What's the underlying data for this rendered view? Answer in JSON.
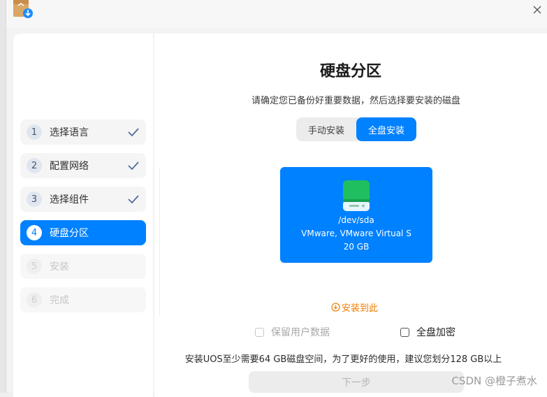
{
  "steps": [
    {
      "num": "1",
      "label": "选择语言",
      "state": "done"
    },
    {
      "num": "2",
      "label": "配置网络",
      "state": "done"
    },
    {
      "num": "3",
      "label": "选择组件",
      "state": "done"
    },
    {
      "num": "4",
      "label": "硬盘分区",
      "state": "active"
    },
    {
      "num": "5",
      "label": "安装",
      "state": "disabled"
    },
    {
      "num": "6",
      "label": "完成",
      "state": "disabled"
    }
  ],
  "page": {
    "title": "硬盘分区",
    "subtitle": "请确定您已备份好重要数据，然后选择要安装的磁盘"
  },
  "mode_switch": {
    "manual": "手动安装",
    "full": "全盘安装",
    "selected": "full"
  },
  "disk": {
    "path": "/dev/sda",
    "model": "VMware, VMware Virtual S",
    "size": "20 GB"
  },
  "install_here": "安装到此",
  "options": {
    "keep_user_data": "保留用户数据",
    "full_disk_encrypt": "全盘加密"
  },
  "note": "安装UOS至少需要64 GB磁盘空间，为了更好的使用，建议您划分128 GB以上",
  "next_label": "下一步",
  "watermark": "CSDN @橙子煮水",
  "colors": {
    "accent": "#0081ff",
    "warning": "#f07d00",
    "disk_green": "#1fbf5f"
  }
}
